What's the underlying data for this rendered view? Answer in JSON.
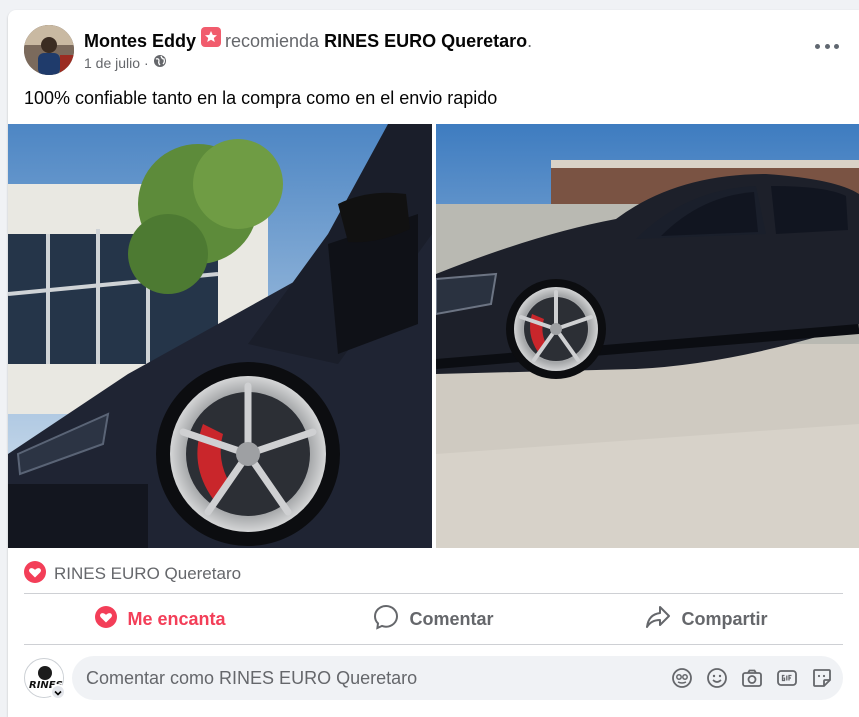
{
  "post": {
    "author": "Montes Eddy",
    "recommends_word": "recomienda",
    "page": "RINES EURO Queretaro",
    "period": ".",
    "date": "1 de julio",
    "separator": "·",
    "text": "100% confiable tanto en la compra como en el envio rapido"
  },
  "reactions": {
    "label": "RINES EURO Queretaro"
  },
  "actions": {
    "love_label": "Me encanta",
    "comment_label": "Comentar",
    "share_label": "Compartir"
  },
  "comment": {
    "placeholder": "Comentar como RINES EURO Queretaro",
    "avatar_text": "RINES"
  },
  "colors": {
    "love": "#f33e58",
    "muted": "#65676b",
    "divider": "#ced0d4"
  },
  "icons": [
    "more-icon",
    "globe-icon",
    "recommend-icon",
    "love-reaction-icon",
    "heart-icon",
    "comment-icon",
    "share-icon",
    "avatar-icon",
    "emoji-icon",
    "camera-icon",
    "gif-icon",
    "sticker-icon"
  ]
}
